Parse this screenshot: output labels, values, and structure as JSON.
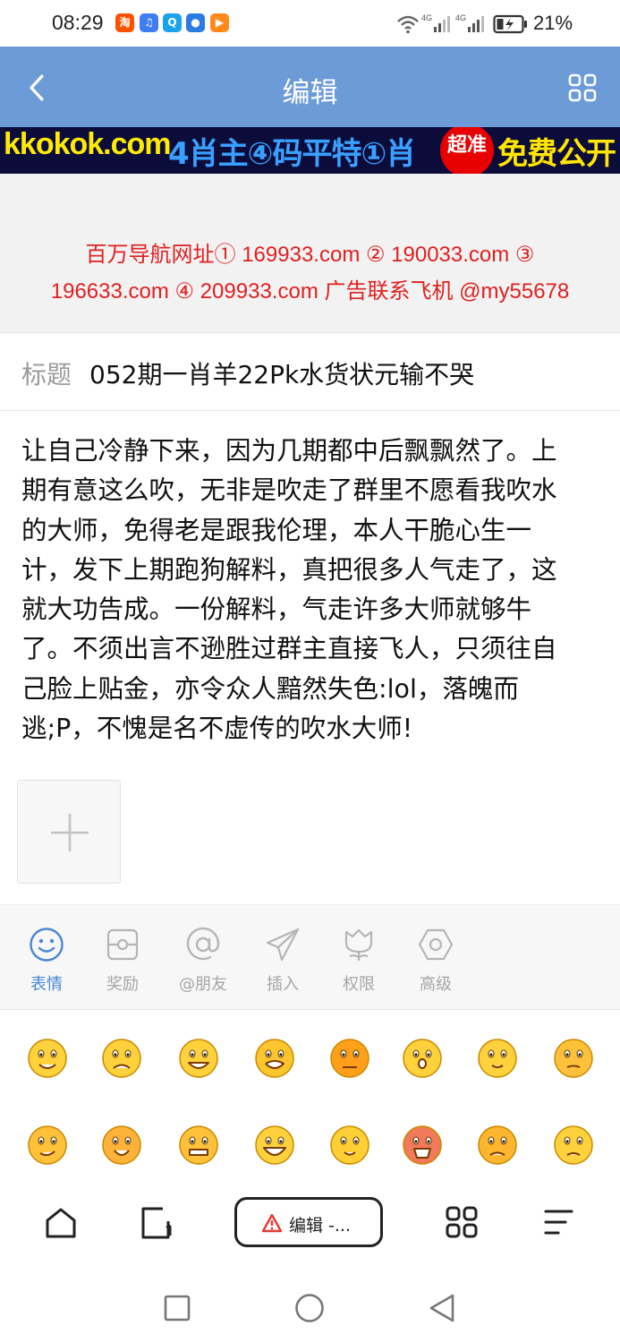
{
  "status_bar": {
    "time": "08:29",
    "app_icons": [
      {
        "name": "taobao-icon",
        "color": "#ff5000",
        "glyph": "淘"
      },
      {
        "name": "music-icon",
        "color": "#3f7df2",
        "glyph": "♫"
      },
      {
        "name": "search-app-icon",
        "color": "#1aa3e8",
        "glyph": "Q"
      },
      {
        "name": "browser-app-icon",
        "color": "#2d7be0",
        "glyph": "●"
      },
      {
        "name": "video-app-icon",
        "color": "#ff8a1a",
        "glyph": "▶"
      }
    ],
    "battery_percent": "21%"
  },
  "header": {
    "title": "编辑",
    "bg_color": "#6c9bd8"
  },
  "ad_banner": {
    "site": "kkokok.com",
    "slogan": "4肖主④码平特①肖",
    "badge": "超准",
    "free_text": "免费公开"
  },
  "nav_links": {
    "line1": "百万导航网址① 169933.com ② 190033.com ③",
    "line2": "196633.com ④ 209933.com 广告联系飞机 @my55678",
    "color": "#e02020"
  },
  "post": {
    "title_label": "标题",
    "title_value": "052期一肖羊22Pk水货状元输不哭",
    "body_lines": [
      "让自己冷静下来，因为几期都中后飘飘然了。上",
      "期有意这么吹，无非是吹走了群里不愿看我吹水",
      "的大师，免得老是跟我伦理，本人干脆心生一",
      "计，发下上期跑狗解料，真把很多人气走了，这",
      "就大功告成。一份解料，气走许多大师就够牛",
      "了。不须出言不逊胜过群主直接飞人，只须往自",
      "己脸上贴金，亦令众人黯然失色:lol，落魄而",
      "逃;P，不愧是名不虚传的吹水大师!"
    ]
  },
  "toolbar": {
    "items": [
      {
        "label": "表情",
        "icon": "smiley-icon",
        "active": true
      },
      {
        "label": "奖励",
        "icon": "reward-icon",
        "active": false
      },
      {
        "label": "@朋友",
        "icon": "at-icon",
        "active": false
      },
      {
        "label": "插入",
        "icon": "paper-plane-icon",
        "active": false
      },
      {
        "label": "权限",
        "icon": "tulip-icon",
        "active": false
      },
      {
        "label": "高级",
        "icon": "hexagon-icon",
        "active": false
      }
    ],
    "active_color": "#4a86d4"
  },
  "emojis": [
    "smile-emoji",
    "sad-emoji",
    "grin-emoji",
    "cry-emoji",
    "angry-emoji",
    "surprised-emoji",
    "blush-emoji",
    "sleepy-emoji",
    "sly-emoji",
    "tongue-emoji",
    "grimace-emoji",
    "laugh-emoji",
    "shy-emoji",
    "shout-emoji",
    "mad-emoji",
    "frown-emoji"
  ],
  "browser_bar": {
    "tab_title": "编辑 -..."
  }
}
